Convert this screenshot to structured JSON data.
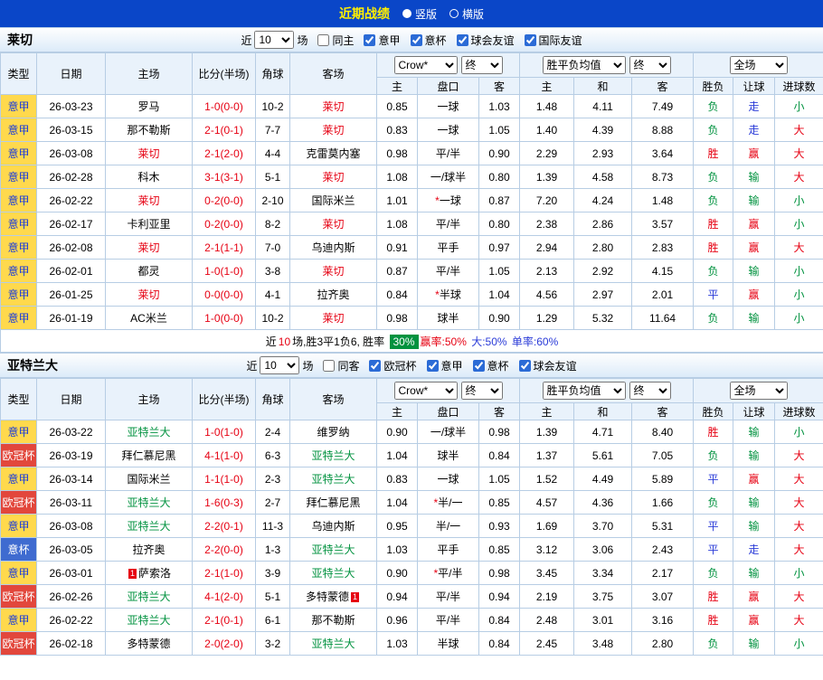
{
  "topbar": {
    "title": "近期战绩",
    "radios": [
      {
        "label": "竖版",
        "selected": true
      },
      {
        "label": "横版",
        "selected": false
      }
    ]
  },
  "colors": {
    "topbar_bg": "#0a46c8",
    "title_color": "#ffef00",
    "accent_red": "#e60012",
    "accent_blue": "#2a3bd8",
    "accent_green": "#01923f",
    "header_bg": "#e9f2fb",
    "border": "#b7cde4",
    "league_styles": {
      "意甲": {
        "bg": "#ffd94d",
        "fg": "#1f3fd8"
      },
      "欧冠杯": {
        "bg": "#e2473c",
        "fg": "#ffffff"
      },
      "意杯": {
        "bg": "#3f6bd0",
        "fg": "#ffffff"
      }
    },
    "team_colors": {
      "莱切": "#e60012",
      "亚特兰大": "#01923f"
    }
  },
  "table_header": {
    "static_cols": [
      "类型",
      "日期",
      "主场",
      "比分(半场)",
      "角球",
      "客场"
    ],
    "odds_selects": [
      "Crow*",
      "终"
    ],
    "wdl_selects": [
      "胜平负均值",
      "终"
    ],
    "result_selects": [
      "全场"
    ],
    "sub_cols": [
      "主",
      "盘口",
      "客",
      "主",
      "和",
      "客",
      "胜负",
      "让球",
      "进球数"
    ]
  },
  "sections": [
    {
      "team": "莱切",
      "filters": {
        "near": "近",
        "count": "10",
        "unit": "场",
        "checkboxes": [
          {
            "label": "同主",
            "checked": false
          },
          {
            "label": "意甲",
            "checked": true
          },
          {
            "label": "意杯",
            "checked": true
          },
          {
            "label": "球会友谊",
            "checked": true
          },
          {
            "label": "国际友谊",
            "checked": true
          }
        ]
      },
      "rows": [
        [
          "意甲",
          "26-03-23",
          "罗马",
          "1-0(0-0)",
          "10-2",
          "莱切",
          "0.85",
          "一球",
          "1.03",
          "1.48",
          "4.11",
          "7.49",
          "负",
          "走",
          "小"
        ],
        [
          "意甲",
          "26-03-15",
          "那不勒斯",
          "2-1(0-1)",
          "7-7",
          "莱切",
          "0.83",
          "一球",
          "1.05",
          "1.40",
          "4.39",
          "8.88",
          "负",
          "走",
          "大"
        ],
        [
          "意甲",
          "26-03-08",
          "莱切",
          "2-1(2-0)",
          "4-4",
          "克雷莫内塞",
          "0.98",
          "平/半",
          "0.90",
          "2.29",
          "2.93",
          "3.64",
          "胜",
          "赢",
          "大"
        ],
        [
          "意甲",
          "26-02-28",
          "科木",
          "3-1(3-1)",
          "5-1",
          "莱切",
          "1.08",
          "一/球半",
          "0.80",
          "1.39",
          "4.58",
          "8.73",
          "负",
          "输",
          "大"
        ],
        [
          "意甲",
          "26-02-22",
          "莱切",
          "0-2(0-0)",
          "2-10",
          "国际米兰",
          "1.01",
          "*一球",
          "0.87",
          "7.20",
          "4.24",
          "1.48",
          "负",
          "输",
          "小"
        ],
        [
          "意甲",
          "26-02-17",
          "卡利亚里",
          "0-2(0-0)",
          "8-2",
          "莱切",
          "1.08",
          "平/半",
          "0.80",
          "2.38",
          "2.86",
          "3.57",
          "胜",
          "赢",
          "小"
        ],
        [
          "意甲",
          "26-02-08",
          "莱切",
          "2-1(1-1)",
          "7-0",
          "乌迪内斯",
          "0.91",
          "平手",
          "0.97",
          "2.94",
          "2.80",
          "2.83",
          "胜",
          "赢",
          "大"
        ],
        [
          "意甲",
          "26-02-01",
          "都灵",
          "1-0(1-0)",
          "3-8",
          "莱切",
          "0.87",
          "平/半",
          "1.05",
          "2.13",
          "2.92",
          "4.15",
          "负",
          "输",
          "小"
        ],
        [
          "意甲",
          "26-01-25",
          "莱切",
          "0-0(0-0)",
          "4-1",
          "拉齐奥",
          "0.84",
          "*半球",
          "1.04",
          "4.56",
          "2.97",
          "2.01",
          "平",
          "赢",
          "小"
        ],
        [
          "意甲",
          "26-01-19",
          "AC米兰",
          "1-0(0-0)",
          "10-2",
          "莱切",
          "0.98",
          "球半",
          "0.90",
          "1.29",
          "5.32",
          "11.64",
          "负",
          "输",
          "小"
        ]
      ],
      "badges": [],
      "summary": {
        "parts": [
          {
            "text": "近"
          },
          {
            "text": "10",
            "color": "#e60012"
          },
          {
            "text": "场,胜3平1负6, 胜率 "
          },
          {
            "text": "30%",
            "box": true
          },
          {
            "text": "赢率:50%",
            "color": "#e60012"
          },
          {
            "text": " 大:50%",
            "color": "#2a3bd8"
          },
          {
            "text": " 单率:60%",
            "color": "#2a3bd8"
          }
        ]
      }
    },
    {
      "team": "亚特兰大",
      "filters": {
        "near": "近",
        "count": "10",
        "unit": "场",
        "checkboxes": [
          {
            "label": "同客",
            "checked": false
          },
          {
            "label": "欧冠杯",
            "checked": true
          },
          {
            "label": "意甲",
            "checked": true
          },
          {
            "label": "意杯",
            "checked": true
          },
          {
            "label": "球会友谊",
            "checked": true
          }
        ]
      },
      "rows": [
        [
          "意甲",
          "26-03-22",
          "亚特兰大",
          "1-0(1-0)",
          "2-4",
          "维罗纳",
          "0.90",
          "一/球半",
          "0.98",
          "1.39",
          "4.71",
          "8.40",
          "胜",
          "输",
          "小"
        ],
        [
          "欧冠杯",
          "26-03-19",
          "拜仁慕尼黑",
          "4-1(1-0)",
          "6-3",
          "亚特兰大",
          "1.04",
          "球半",
          "0.84",
          "1.37",
          "5.61",
          "7.05",
          "负",
          "输",
          "大"
        ],
        [
          "意甲",
          "26-03-14",
          "国际米兰",
          "1-1(1-0)",
          "2-3",
          "亚特兰大",
          "0.83",
          "一球",
          "1.05",
          "1.52",
          "4.49",
          "5.89",
          "平",
          "赢",
          "大"
        ],
        [
          "欧冠杯",
          "26-03-11",
          "亚特兰大",
          "1-6(0-3)",
          "2-7",
          "拜仁慕尼黑",
          "1.04",
          "*半/一",
          "0.85",
          "4.57",
          "4.36",
          "1.66",
          "负",
          "输",
          "大"
        ],
        [
          "意甲",
          "26-03-08",
          "亚特兰大",
          "2-2(0-1)",
          "11-3",
          "乌迪内斯",
          "0.95",
          "半/一",
          "0.93",
          "1.69",
          "3.70",
          "5.31",
          "平",
          "输",
          "大"
        ],
        [
          "意杯",
          "26-03-05",
          "拉齐奥",
          "2-2(0-0)",
          "1-3",
          "亚特兰大",
          "1.03",
          "平手",
          "0.85",
          "3.12",
          "3.06",
          "2.43",
          "平",
          "走",
          "大"
        ],
        [
          "意甲",
          "26-03-01",
          "萨索洛",
          "2-1(1-0)",
          "3-9",
          "亚特兰大",
          "0.90",
          "*平/半",
          "0.98",
          "3.45",
          "3.34",
          "2.17",
          "负",
          "输",
          "小"
        ],
        [
          "欧冠杯",
          "26-02-26",
          "亚特兰大",
          "4-1(2-0)",
          "5-1",
          "多特蒙德",
          "0.94",
          "平/半",
          "0.94",
          "2.19",
          "3.75",
          "3.07",
          "胜",
          "赢",
          "大"
        ],
        [
          "意甲",
          "26-02-22",
          "亚特兰大",
          "2-1(0-1)",
          "6-1",
          "那不勒斯",
          "0.96",
          "平/半",
          "0.84",
          "2.48",
          "3.01",
          "3.16",
          "胜",
          "赢",
          "大"
        ],
        [
          "欧冠杯",
          "26-02-18",
          "多特蒙德",
          "2-0(2-0)",
          "3-2",
          "亚特兰大",
          "1.03",
          "半球",
          "0.84",
          "2.45",
          "3.48",
          "2.80",
          "负",
          "输",
          "小"
        ]
      ],
      "badges": [
        {
          "row": 6,
          "side": "home",
          "text": "1",
          "pos": "before"
        },
        {
          "row": 7,
          "side": "away",
          "text": "1",
          "pos": "after"
        }
      ],
      "summary": null
    }
  ]
}
